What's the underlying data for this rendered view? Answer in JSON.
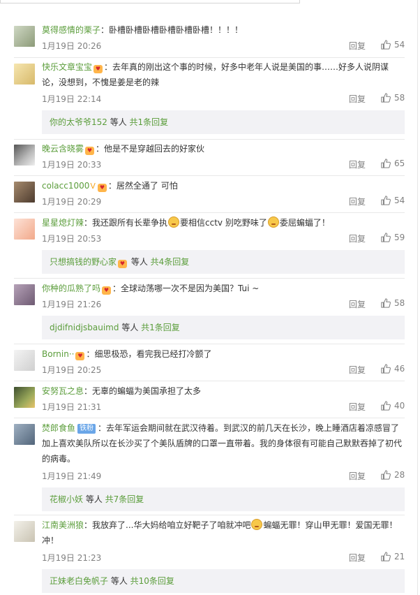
{
  "comments": [
    {
      "user": "莫得感情的栗子",
      "text": "：卧槽卧槽卧槽卧槽卧槽卧槽！！！！",
      "time": "1月19日 20:26",
      "reply": "回复",
      "likes": "54"
    },
    {
      "user": "快乐文章宝宝",
      "text_l1": "：去年真的刚出这个事的时候，好多中老年人说是美国的事……好多人说阴谋",
      "text_l2": "论，没想到，不愧是姜是老的辣",
      "time": "1月19日 22:14",
      "reply": "回复",
      "likes": "58",
      "sub": {
        "user": "你的太爷爷152",
        "mid": " 等人 ",
        "more": "共1条回复"
      }
    },
    {
      "user": "晚云含晓雾",
      "text": "：他是不是穿越回去的好家伙",
      "time": "1月19日 20:33",
      "reply": "回复",
      "likes": "65"
    },
    {
      "user": "colacc1000",
      "text": "：居然全通了 可怕",
      "time": "1月19日 20:29",
      "reply": "回复",
      "likes": "54"
    },
    {
      "user": "星星熄灯辣",
      "text_a": "：我还跟所有长辈争执",
      "text_b": "要相信cctv 别吃野味了",
      "text_c": "委屈蝙蝠了！",
      "time": "1月19日 20:53",
      "reply": "回复",
      "likes": "59",
      "sub": {
        "user": "只想搞钱的野心家",
        "mid": " 等人 ",
        "more": "共4条回复"
      }
    },
    {
      "user": "你种的瓜熟了吗",
      "text": "：全球动荡哪一次不是因为美国？Tui ~",
      "time": "1月19日 21:26",
      "reply": "回复",
      "likes": "58",
      "sub": {
        "user": "djdifnidjsbauimd",
        "mid": " 等人 ",
        "more": "共1条回复"
      }
    },
    {
      "user": "Bornin··",
      "text": "：细思极恐，看完我已经打冷颤了",
      "time": "1月19日 20:25",
      "reply": "回复",
      "likes": "46"
    },
    {
      "user": "安努瓦之息",
      "text": "：无辜的蝙蝠为美国承担了太多",
      "time": "1月19日 21:31",
      "reply": "回复",
      "likes": "40"
    },
    {
      "user": "焚郎食鱼",
      "badge": "铁粉",
      "text_l1": "：去年军运会期间就在武汉待着。到武汉的前几天在长沙，晚上睡酒店着凉感冒了",
      "text_l2": "加上喜欢美队所以在长沙买了个美队盾牌的口罩一直带着。我的身体很有可能自己默默吞掉了初代",
      "text_l3": "的病毒。",
      "time": "1月19日 21:49",
      "reply": "回复",
      "likes": "28",
      "sub": {
        "user": "花椒小妖",
        "mid": " 等人 ",
        "more": "共7条回复"
      }
    },
    {
      "user": "江南美洲狼",
      "text_a": "：我放弃了...华大妈给咱立好靶子了咱就冲吧",
      "text_b": "蝙蝠无罪！穿山甲无罪！爱国无罪！",
      "text_l2": "冲！",
      "time": "1月19日 21:23",
      "reply": "回复",
      "likes": "21",
      "sub": {
        "user": "正妹老白免帆子",
        "mid": " 等人 ",
        "more": "共10条回复"
      }
    }
  ],
  "icons": {
    "like": "thumbs-up-icon",
    "medal": "fan-medal-icon",
    "vip": "v-badge-icon"
  },
  "colors": {
    "username": "#5b9d3b",
    "meta": "#808080",
    "reply_box": "#f2f2f5"
  }
}
